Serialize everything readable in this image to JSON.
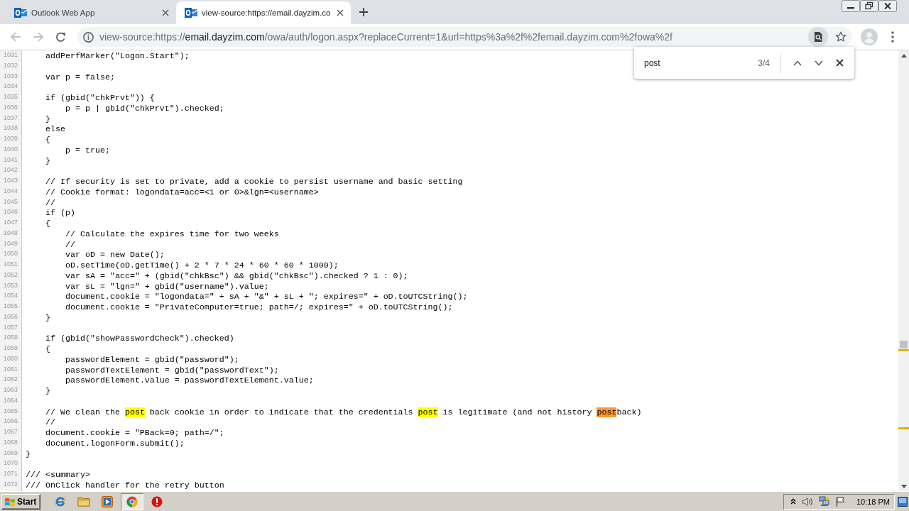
{
  "window": {
    "tabs": [
      {
        "title": "Outlook Web App",
        "selected": false
      },
      {
        "title": "view-source:https://email.dayzim.co",
        "selected": true
      }
    ]
  },
  "navigation": {
    "back": {
      "disabled": true
    },
    "forward": {
      "disabled": true
    }
  },
  "address_bar": {
    "url": [
      {
        "text": "view-source:https://",
        "host": false
      },
      {
        "text": "email.dayzim.com",
        "host": true
      },
      {
        "text": "/owa/auth/logon.aspx?replaceCurrent=1&url=https%3a%2f%2femail.dayzim.com%2fowa%2f",
        "host": false
      }
    ]
  },
  "find_bar": {
    "query": "post",
    "count": "3/4"
  },
  "source": {
    "lines": [
      {
        "number": "1031",
        "code": "    addPerfMarker(\"Logon.Start\");"
      },
      {
        "number": "1032"
      },
      {
        "number": "1033",
        "code": "    var p = false;"
      },
      {
        "number": "1034"
      },
      {
        "number": "1035",
        "code": "    if (gbid(\"chkPrvt\")) {"
      },
      {
        "number": "1036",
        "code": "        p = p | gbid(\"chkPrvt\").checked;"
      },
      {
        "number": "1037",
        "code": "    }"
      },
      {
        "number": "1038",
        "code": "    else"
      },
      {
        "number": "1039",
        "code": "    {"
      },
      {
        "number": "1040",
        "code": "        p = true;"
      },
      {
        "number": "1041",
        "code": "    }"
      },
      {
        "number": "1042"
      },
      {
        "number": "1043",
        "code": "    // If security is set to private, add a cookie to persist username and basic setting"
      },
      {
        "number": "1044",
        "code": "    // Cookie format: logondata=acc=<1 or 0>&lgn=<username>"
      },
      {
        "number": "1045",
        "code": "    //"
      },
      {
        "number": "1046",
        "code": "    if (p)"
      },
      {
        "number": "1047",
        "code": "    {"
      },
      {
        "number": "1048",
        "code": "        // Calculate the expires time for two weeks"
      },
      {
        "number": "1049",
        "code": "        //"
      },
      {
        "number": "1050",
        "code": "        var oD = new Date();"
      },
      {
        "number": "1051",
        "code": "        oD.setTime(oD.getTime() + 2 * 7 * 24 * 60 * 60 * 1000);"
      },
      {
        "number": "1052",
        "code": "        var sA = \"acc=\" + (gbid(\"chkBsc\") && gbid(\"chkBsc\").checked ? 1 : 0);"
      },
      {
        "number": "1053",
        "code": "        var sL = \"lgn=\" + gbid(\"username\").value;"
      },
      {
        "number": "1054",
        "code": "        document.cookie = \"logondata=\" + sA + \"&\" + sL + \"; expires=\" + oD.toUTCString();"
      },
      {
        "number": "1055",
        "code": "        document.cookie = \"PrivateComputer=true; path=/; expires=\" + oD.toUTCString();"
      },
      {
        "number": "1056",
        "code": "    }"
      },
      {
        "number": "1057"
      },
      {
        "number": "1058",
        "code": "    if (gbid(\"showPasswordCheck\").checked)"
      },
      {
        "number": "1059",
        "code": "    {"
      },
      {
        "number": "1060",
        "code": "        passwordElement = gbid(\"password\");"
      },
      {
        "number": "1061",
        "code": "        passwordTextElement = gbid(\"passwordText\");"
      },
      {
        "number": "1062",
        "code": "        passwordElement.value = passwordTextElement.value;"
      },
      {
        "number": "1063",
        "code": "    }"
      },
      {
        "number": "1064"
      },
      {
        "number": "1065",
        "segments": [
          {
            "text": "    // We clean the ",
            "highlighted": false,
            "current": false
          },
          {
            "text": "post",
            "highlighted": true,
            "current": false
          },
          {
            "text": " back cookie in order to indicate that the credentials ",
            "highlighted": false,
            "current": false
          },
          {
            "text": "post",
            "highlighted": true,
            "current": false
          },
          {
            "text": " is legitimate (and not history ",
            "highlighted": false,
            "current": false
          },
          {
            "text": "post",
            "highlighted": true,
            "current": true
          },
          {
            "text": "back)",
            "highlighted": false,
            "current": false
          }
        ]
      },
      {
        "number": "1066",
        "code": "    //"
      },
      {
        "number": "1067",
        "code": "    document.cookie = \"PBack=0; path=/\";"
      },
      {
        "number": "1068",
        "code": "    document.logonForm.submit();"
      },
      {
        "number": "1069",
        "code": "}"
      },
      {
        "number": "1070"
      },
      {
        "number": "1071",
        "code": "/// <summary>"
      },
      {
        "number": "1072",
        "code": "/// OnClick handler for the retry button"
      }
    ]
  },
  "taskbar": {
    "start": "Start",
    "apps": [
      {
        "selected": false
      },
      {
        "selected": false
      },
      {
        "selected": false
      },
      {
        "selected": true
      },
      {
        "selected": false
      }
    ],
    "clock": "10:18 PM"
  }
}
